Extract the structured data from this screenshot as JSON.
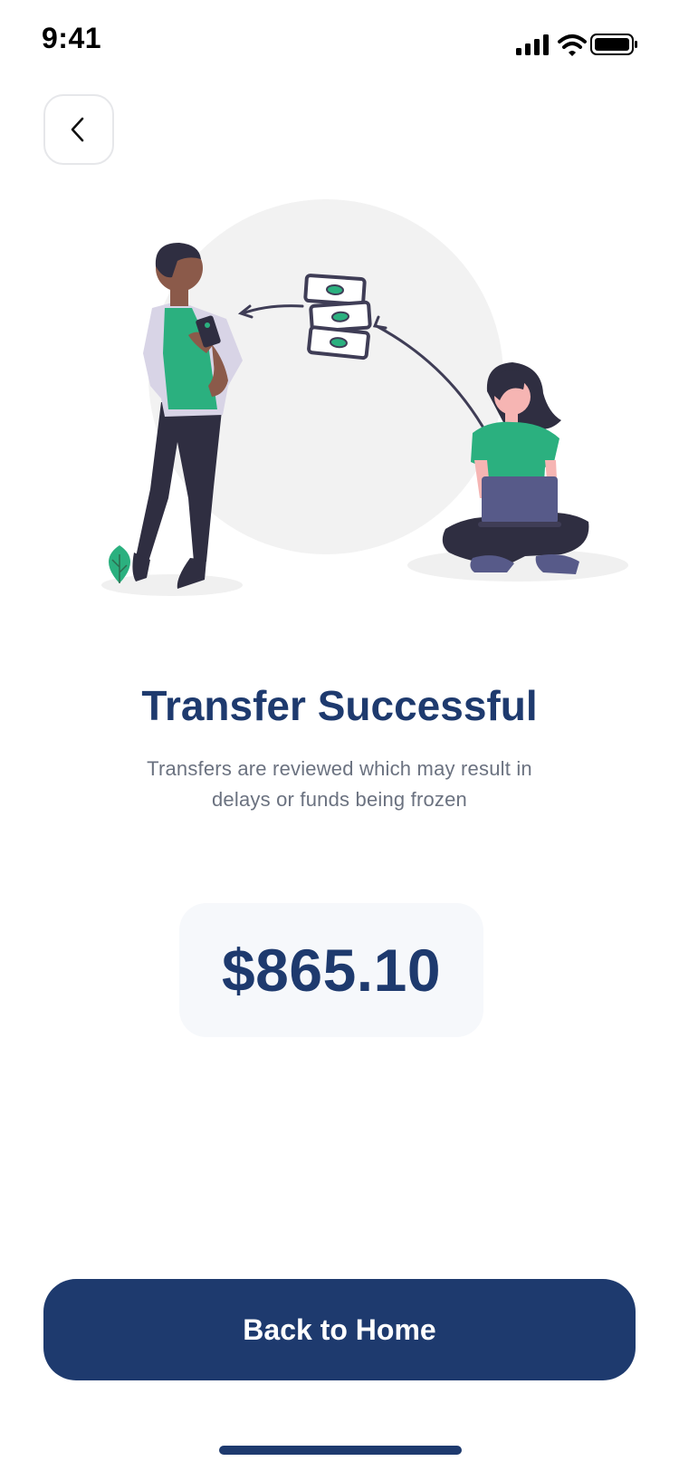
{
  "status_bar": {
    "time": "9:41",
    "icons": [
      "cellular-signal-icon",
      "wifi-icon",
      "battery-icon"
    ]
  },
  "header": {
    "back_icon": "chevron-left-icon"
  },
  "main": {
    "title": "Transfer Successful",
    "subtitle": "Transfers are reviewed which may result in delays or funds being frozen",
    "amount": "$865.10"
  },
  "actions": {
    "home_button_label": "Back to Home"
  },
  "colors": {
    "primary": "#1e3a6e",
    "accent_green": "#2bb07f",
    "text_muted": "#6b7280",
    "card_bg": "#f6f8fb"
  }
}
